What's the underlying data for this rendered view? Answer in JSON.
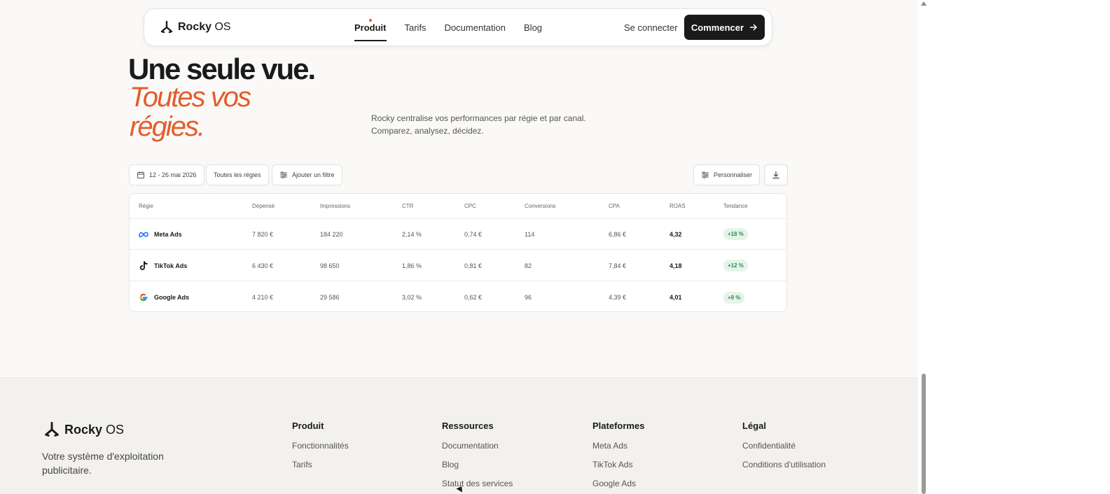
{
  "brand": {
    "name_bold": "Rocky",
    "name_light": " OS"
  },
  "nav": {
    "links": [
      "Produit",
      "Tarifs",
      "Documentation",
      "Blog"
    ],
    "login": "Se connecter",
    "cta": "Commencer"
  },
  "hero": {
    "line1": "Une seule vue.",
    "line2": "Toutes vos régies.",
    "sub1": "Rocky centralise vos performances par régie et par canal.",
    "sub2": "Comparez, analysez, décidez."
  },
  "filters": {
    "date": "12 - 26 mai 2026",
    "regies": "Toutes les régies",
    "add": "Ajouter un filtre",
    "customize": "Personnaliser"
  },
  "table": {
    "headers": [
      "Régie",
      "Dépensé",
      "Impressions",
      "CTR",
      "CPC",
      "Conversions",
      "CPA",
      "ROAS",
      "Tendance"
    ],
    "rows": [
      {
        "icon": "meta-icon",
        "name": "Meta Ads",
        "spent": "7 820 €",
        "impressions": "184 220",
        "ctr": "2,14 %",
        "cpc": "0,74 €",
        "conversions": "114",
        "cpa": "6,86 €",
        "roas": "4,32",
        "trend": "+18 %"
      },
      {
        "icon": "tiktok-icon",
        "name": "TikTok Ads",
        "spent": "6 430 €",
        "impressions": "98 650",
        "ctr": "1,86 %",
        "cpc": "0,81 €",
        "conversions": "82",
        "cpa": "7,84 €",
        "roas": "4,18",
        "trend": "+12 %"
      },
      {
        "icon": "google-icon",
        "name": "Google Ads",
        "spent": "4 210 €",
        "impressions": "29 586",
        "ctr": "3,02 %",
        "cpc": "0,62 €",
        "conversions": "96",
        "cpa": "4,39 €",
        "roas": "4,01",
        "trend": "+9 %"
      }
    ]
  },
  "footer": {
    "tagline": "Votre système d'exploitation publicitaire.",
    "columns": [
      {
        "title": "Produit",
        "links": [
          "Fonctionnalités",
          "Tarifs"
        ]
      },
      {
        "title": "Ressources",
        "links": [
          "Documentation",
          "Blog",
          "Statut des services"
        ]
      },
      {
        "title": "Plateformes",
        "links": [
          "Meta Ads",
          "TikTok Ads",
          "Google Ads"
        ]
      },
      {
        "title": "Légal",
        "links": [
          "Confidentialité",
          "Conditions d'utilisation"
        ]
      }
    ]
  },
  "colors": {
    "accent": "#e35d2b",
    "dark": "#1a1a1a",
    "positive": "#2f8a4a"
  }
}
